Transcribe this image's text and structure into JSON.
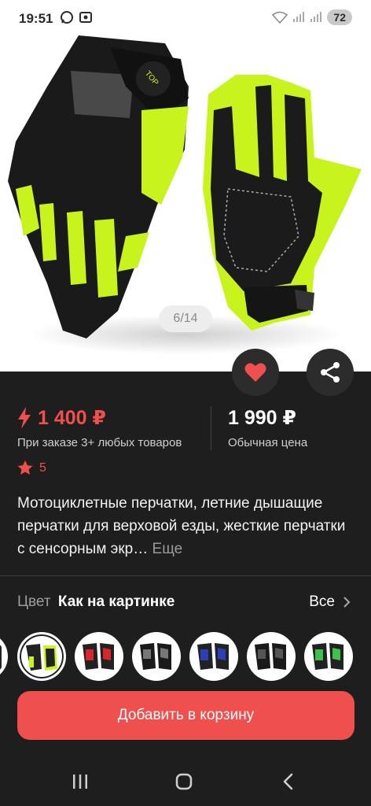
{
  "status_bar": {
    "time": "19:51",
    "battery": "72"
  },
  "gallery": {
    "counter": "6/14"
  },
  "price": {
    "promo_value": "1 400 ₽",
    "promo_caption": "При заказе 3+ любых товаров",
    "regular_value": "1 990 ₽",
    "regular_caption": "Обычная цена"
  },
  "rating": {
    "value": "5"
  },
  "product": {
    "title": "Мотоциклетные перчатки, летние дышащие перчатки для верховой езды, жесткие перчатки с сенсорным экр…",
    "more_label": "Еще"
  },
  "variants": {
    "label": "Цвет",
    "value": "Как на картинке",
    "all_label": "Все"
  },
  "cart": {
    "button_label": "Добавить в корзину"
  },
  "colors": {
    "accent": "#f0504d",
    "background": "#1e1e1e",
    "glove_green": "#c9f31d"
  }
}
